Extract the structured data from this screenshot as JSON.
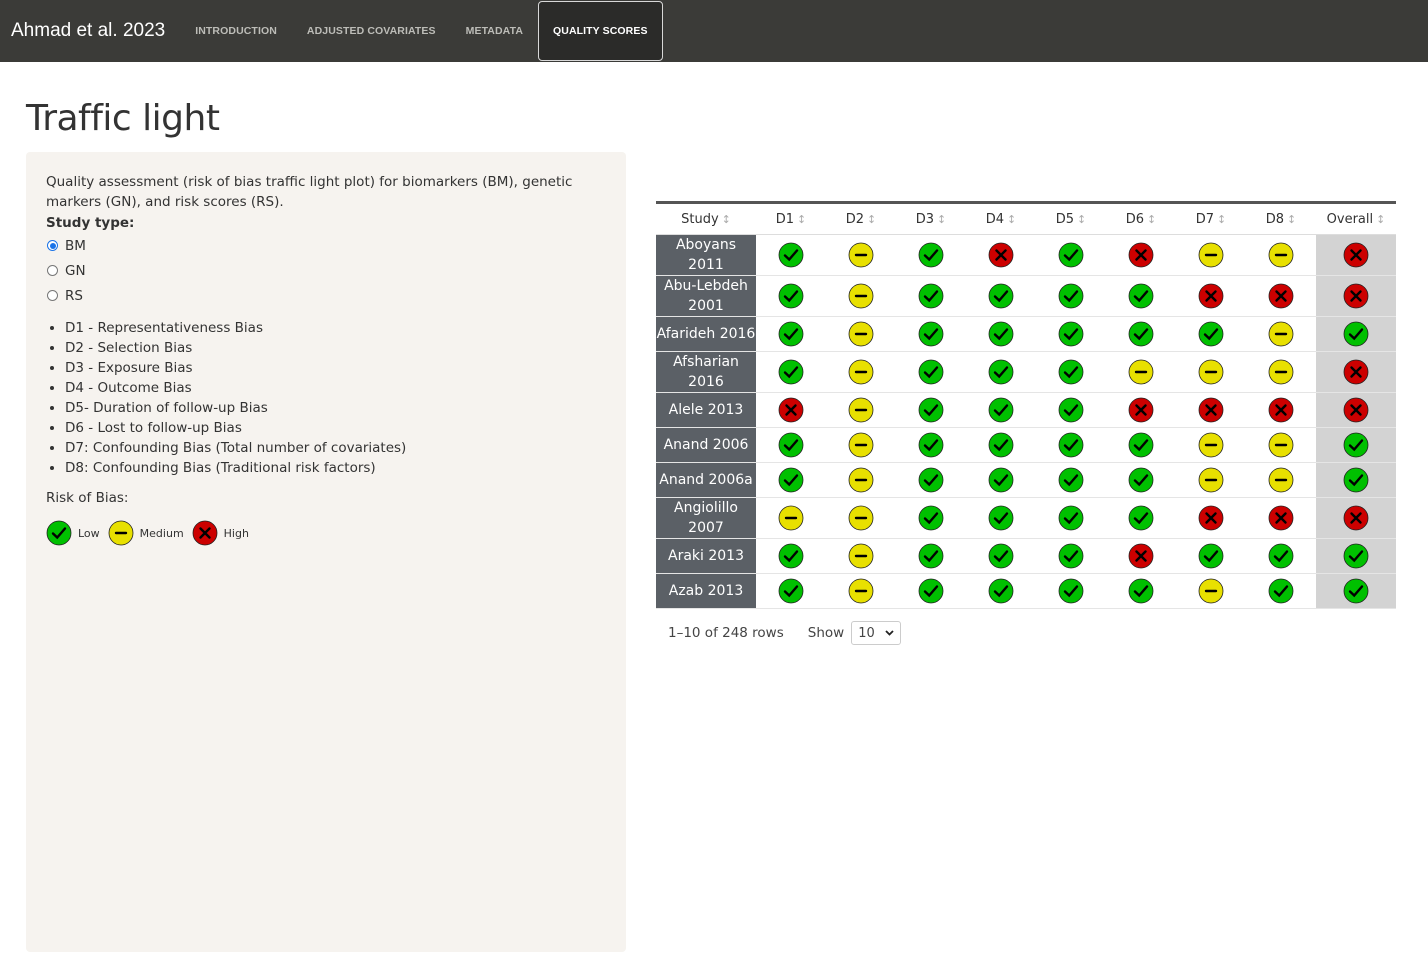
{
  "navbar": {
    "brand": "Ahmad et al. 2023",
    "items": [
      "INTRODUCTION",
      "ADJUSTED COVARIATES",
      "METADATA",
      "QUALITY SCORES"
    ],
    "active_index": 3
  },
  "page": {
    "title": "Traffic light"
  },
  "sidebar": {
    "description": "Quality assessment (risk of bias traffic light plot) for biomarkers (BM), genetic markers (GN), and risk scores (RS).",
    "study_type_label": "Study type:",
    "study_types": [
      "BM",
      "GN",
      "RS"
    ],
    "selected_study_type": "BM",
    "domains": [
      "D1 - Representativeness Bias",
      "D2 - Selection Bias",
      "D3 - Exposure Bias",
      "D4 - Outcome Bias",
      "D5- Duration of follow-up Bias",
      "D6 - Lost to follow-up Bias",
      "D7: Confounding Bias (Total number of covariates)",
      "D8: Confounding Bias (Traditional risk factors)"
    ],
    "risk_label": "Risk of Bias:",
    "legend": [
      {
        "level": "low",
        "label": "Low"
      },
      {
        "level": "medium",
        "label": "Medium"
      },
      {
        "level": "high",
        "label": "High"
      }
    ]
  },
  "colors": {
    "low": "#00c000",
    "medium": "#e8e000",
    "high": "#cc0000"
  },
  "table": {
    "columns": [
      "Study",
      "D1",
      "D2",
      "D3",
      "D4",
      "D5",
      "D6",
      "D7",
      "D8",
      "Overall"
    ],
    "sort_icon": "↕",
    "rows": [
      {
        "study": "Aboyans 2011",
        "ratings": [
          "low",
          "medium",
          "low",
          "high",
          "low",
          "high",
          "medium",
          "medium",
          "high"
        ]
      },
      {
        "study": "Abu-Lebdeh 2001",
        "ratings": [
          "low",
          "medium",
          "low",
          "low",
          "low",
          "low",
          "high",
          "high",
          "high"
        ]
      },
      {
        "study": "Afarideh 2016",
        "ratings": [
          "low",
          "medium",
          "low",
          "low",
          "low",
          "low",
          "low",
          "medium",
          "low"
        ]
      },
      {
        "study": "Afsharian 2016",
        "ratings": [
          "low",
          "medium",
          "low",
          "low",
          "low",
          "medium",
          "medium",
          "medium",
          "high"
        ]
      },
      {
        "study": "Alele 2013",
        "ratings": [
          "high",
          "medium",
          "low",
          "low",
          "low",
          "high",
          "high",
          "high",
          "high"
        ]
      },
      {
        "study": "Anand 2006",
        "ratings": [
          "low",
          "medium",
          "low",
          "low",
          "low",
          "low",
          "medium",
          "medium",
          "low"
        ]
      },
      {
        "study": "Anand 2006a",
        "ratings": [
          "low",
          "medium",
          "low",
          "low",
          "low",
          "low",
          "medium",
          "medium",
          "low"
        ]
      },
      {
        "study": "Angiolillo 2007",
        "ratings": [
          "medium",
          "medium",
          "low",
          "low",
          "low",
          "low",
          "high",
          "high",
          "high"
        ]
      },
      {
        "study": "Araki 2013",
        "ratings": [
          "low",
          "medium",
          "low",
          "low",
          "low",
          "high",
          "low",
          "low",
          "low"
        ]
      },
      {
        "study": "Azab 2013",
        "ratings": [
          "low",
          "medium",
          "low",
          "low",
          "low",
          "low",
          "medium",
          "low",
          "low"
        ]
      }
    ]
  },
  "pagination": {
    "range_text": "1–10 of 248 rows",
    "show_label": "Show",
    "page_size": "10"
  }
}
